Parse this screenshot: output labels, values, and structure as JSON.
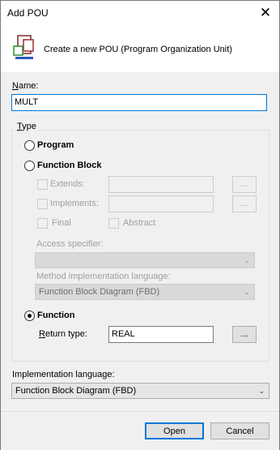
{
  "window": {
    "title": "Add POU",
    "close_glyph": "✕"
  },
  "header": {
    "text": "Create a new POU (Program Organization Unit)",
    "icon": "pou-icon"
  },
  "name": {
    "label": "Name:",
    "value": "MULT"
  },
  "type_group": {
    "caption": "Type",
    "program": {
      "label": "Program",
      "selected": false
    },
    "function_block": {
      "label": "Function Block",
      "selected": false,
      "extends": {
        "label": "Extends:",
        "value": "",
        "browse": "..."
      },
      "implements": {
        "label": "Implements:",
        "value": "",
        "browse": "..."
      },
      "final": {
        "label": "Final"
      },
      "abstract": {
        "label": "Abstract"
      },
      "access_specifier": {
        "label": "Access specifier:",
        "value": ""
      },
      "method_language": {
        "label": "Method implementation language:",
        "value": "Function Block Diagram (FBD)"
      }
    },
    "function": {
      "label": "Function",
      "selected": true,
      "return_type": {
        "label": "Return type:",
        "value": "REAL",
        "browse": "..."
      }
    }
  },
  "implementation_language": {
    "label": "Implementation language:",
    "value": "Function Block Diagram (FBD)"
  },
  "buttons": {
    "open": "Open",
    "cancel": "Cancel"
  },
  "colors": {
    "accent": "#0078d7",
    "disabled_text": "#a0a0a0"
  }
}
